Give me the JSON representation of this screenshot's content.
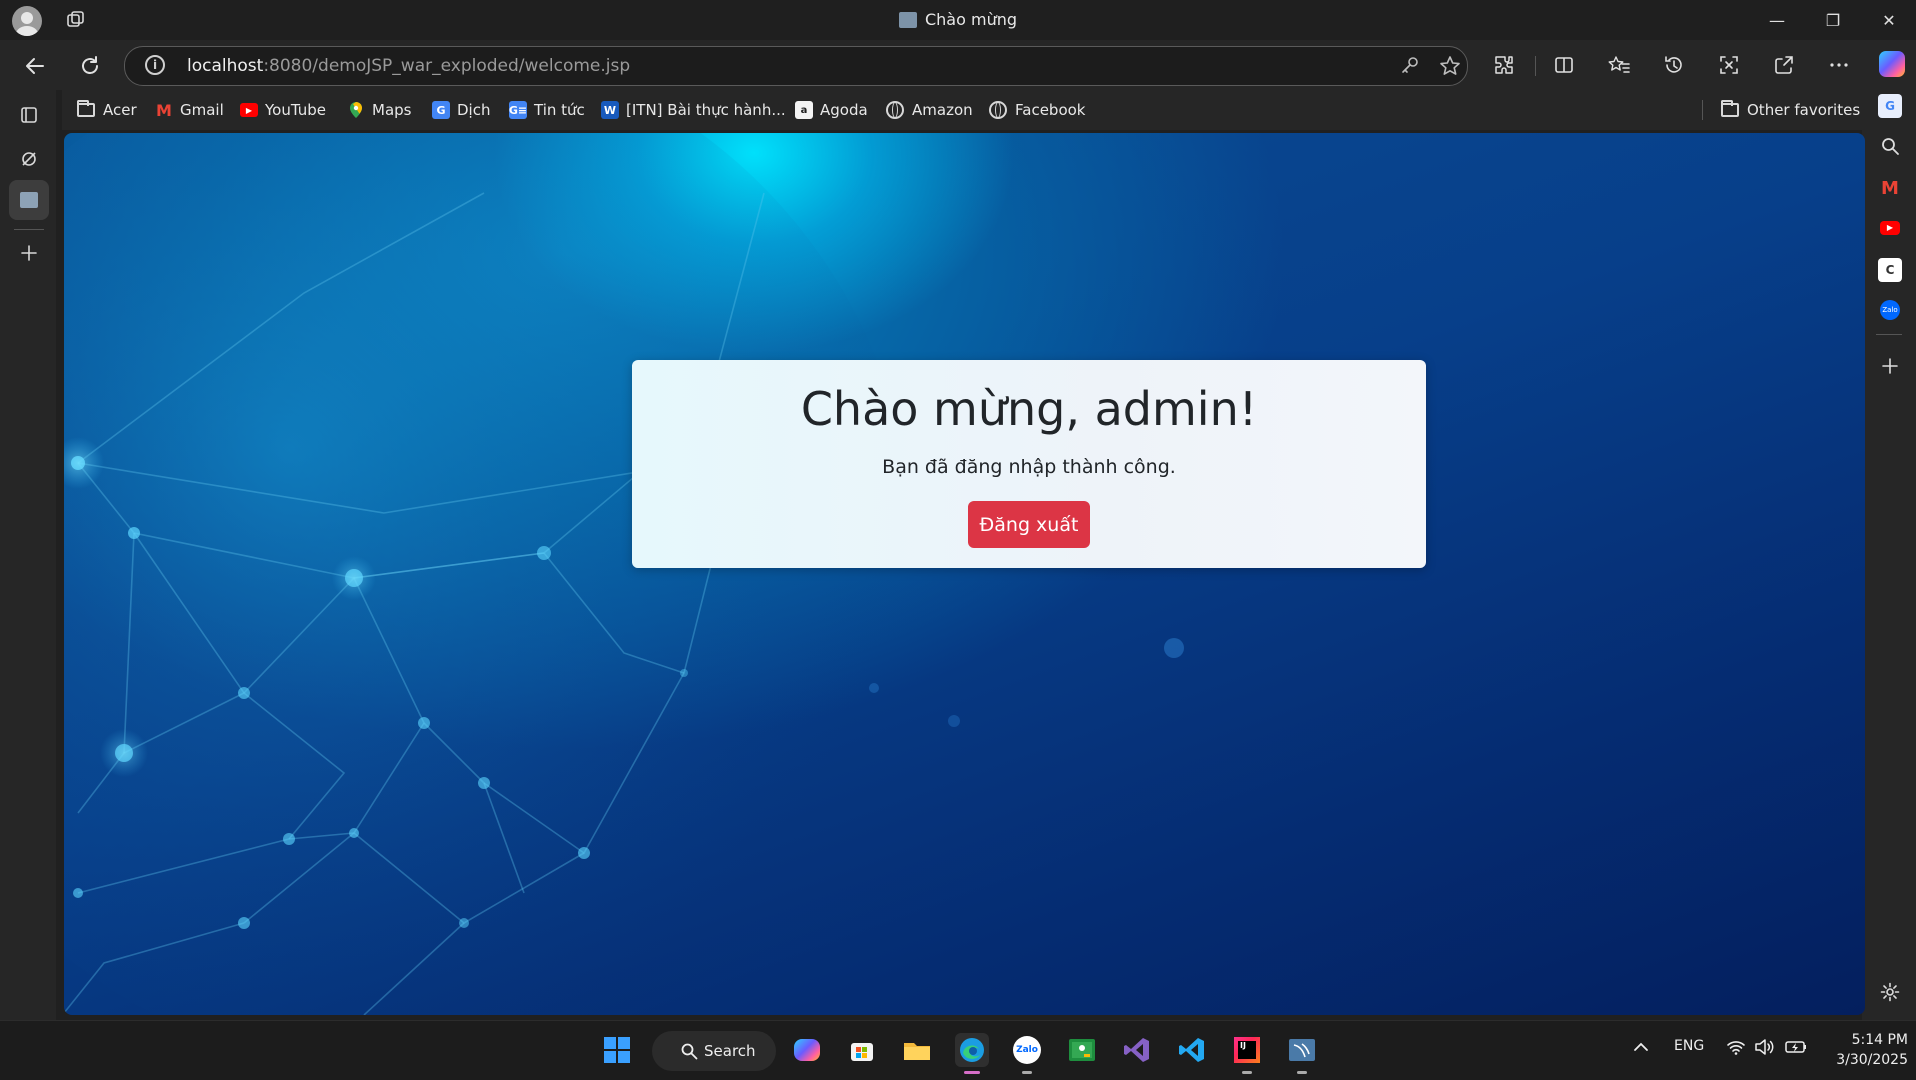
{
  "window": {
    "title": "Chào mừng",
    "controls": {
      "minimize": "—",
      "restore": "❐",
      "close": "✕"
    }
  },
  "address_bar": {
    "host": "localhost",
    "rest": ":8080/demoJSP_war_exploded/welcome.jsp"
  },
  "favorites": {
    "items": [
      {
        "label": "Acer",
        "icon": "folder-icon"
      },
      {
        "label": "Gmail",
        "icon": "gmail-icon",
        "color": "#ea4335"
      },
      {
        "label": "YouTube",
        "icon": "youtube-icon",
        "color": "#ff0000"
      },
      {
        "label": "Maps",
        "icon": "maps-icon",
        "color": "#34a853"
      },
      {
        "label": "Dịch",
        "icon": "translate-icon",
        "color": "#4285f4"
      },
      {
        "label": "Tin tức",
        "icon": "news-icon",
        "color": "#4285f4"
      },
      {
        "label": "[ITN] Bài thực hành...",
        "icon": "word-icon",
        "color": "#185abd"
      },
      {
        "label": "Agoda",
        "icon": "agoda-icon"
      },
      {
        "label": "Amazon",
        "icon": "globe-icon"
      },
      {
        "label": "Facebook",
        "icon": "globe-icon"
      }
    ],
    "other": "Other favorites"
  },
  "page": {
    "heading": "Chào mừng, admin!",
    "message": "Bạn đã đăng nhập thành công.",
    "logout_label": "Đăng xuất",
    "logout_color": "#dc3545"
  },
  "taskbar": {
    "search_label": "Search",
    "language": "ENG",
    "time": "5:14 PM",
    "date": "3/30/2025"
  }
}
